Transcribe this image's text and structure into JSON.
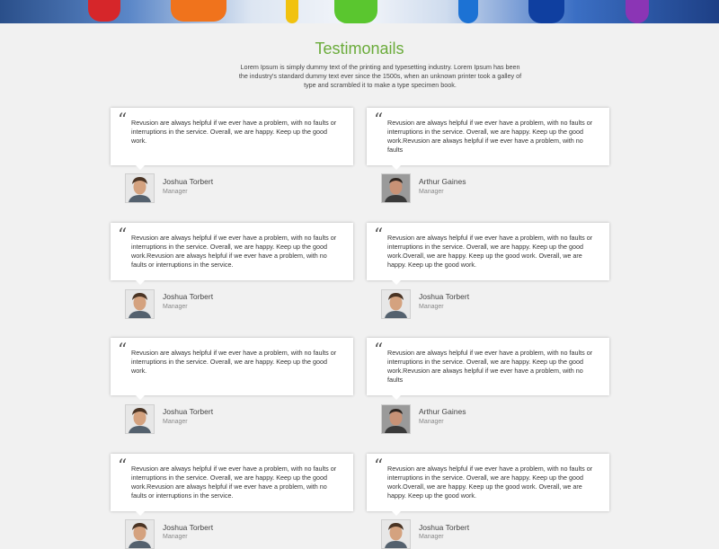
{
  "page": {
    "title": "Testimonails",
    "intro": "Lorem Ipsum is simply dummy text of the printing and typesetting industry. Lorem Ipsum has been the industry's standard dummy text ever since the 1500s, when an unknown printer took a galley of type and scrambled it to make a type specimen book."
  },
  "testimonials": [
    {
      "quote": "Revusion are always helpful if we ever have a problem, with no faults or interruptions in the service. Overall, we are happy. Keep up the good work.",
      "name": "Joshua Torbert",
      "role": "Manager",
      "avatar_icon": "person-photo-icon"
    },
    {
      "quote": "Revusion are always helpful if we ever have a problem, with no faults or interruptions in the service. Overall, we are happy. Keep up the good work.Revusion are always helpful if we ever have a problem, with no faults",
      "name": "Arthur Gaines",
      "role": "Manager",
      "avatar_icon": "person-photo-icon"
    },
    {
      "quote": "Revusion are always helpful if we ever have a problem, with no faults or interruptions in the service. Overall, we are happy. Keep up the good work.Revusion are always helpful if we ever have a problem, with no faults or interruptions in the service.",
      "name": "Joshua Torbert",
      "role": "Manager",
      "avatar_icon": "person-photo-icon"
    },
    {
      "quote": "Revusion are always helpful if we ever have a problem, with no faults or interruptions in the service. Overall, we are happy. Keep up the good work.Overall, we are happy. Keep up the good work. Overall, we are happy. Keep up the good work.",
      "name": "Joshua Torbert",
      "role": "Manager",
      "avatar_icon": "person-photo-icon"
    },
    {
      "quote": "Revusion are always helpful if we ever have a problem, with no faults or interruptions in the service. Overall, we are happy. Keep up the good work.",
      "name": "Joshua Torbert",
      "role": "Manager",
      "avatar_icon": "person-photo-icon"
    },
    {
      "quote": "Revusion are always helpful if we ever have a problem, with no faults or interruptions in the service. Overall, we are happy. Keep up the good work.Revusion are always helpful if we ever have a problem, with no faults",
      "name": "Arthur Gaines",
      "role": "Manager",
      "avatar_icon": "person-photo-icon"
    },
    {
      "quote": "Revusion are always helpful if we ever have a problem, with no faults or interruptions in the service. Overall, we are happy. Keep up the good work.Revusion are always helpful if we ever have a problem, with no faults or interruptions in the service.",
      "name": "Joshua Torbert",
      "role": "Manager",
      "avatar_icon": "person-photo-icon"
    },
    {
      "quote": "Revusion are always helpful if we ever have a problem, with no faults or interruptions in the service. Overall, we are happy. Keep up the good work.Overall, we are happy. Keep up the good work. Overall, we are happy. Keep up the good work.",
      "name": "Joshua Torbert",
      "role": "Manager",
      "avatar_icon": "person-photo-icon"
    }
  ],
  "colors": {
    "accent": "#6aab3a",
    "background": "#f1f1f1"
  }
}
